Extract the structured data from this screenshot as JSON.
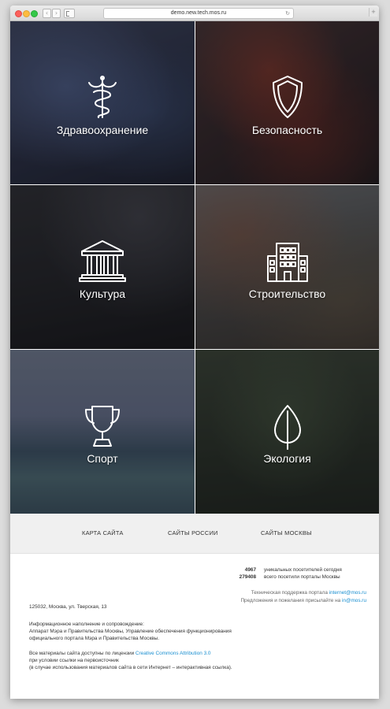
{
  "browser": {
    "url": "demo.new.tech.mos.ru",
    "reload_glyph": "↻",
    "back_glyph": "‹",
    "forward_glyph": "›",
    "newtab_glyph": "+"
  },
  "tiles": [
    {
      "label": "Здравоохранение",
      "icon": "caduceus-icon"
    },
    {
      "label": "Безопасность",
      "icon": "shield-icon"
    },
    {
      "label": "Культура",
      "icon": "museum-icon"
    },
    {
      "label": "Строительство",
      "icon": "building-icon"
    },
    {
      "label": "Спорт",
      "icon": "trophy-icon"
    },
    {
      "label": "Экология",
      "icon": "leaf-icon"
    }
  ],
  "footer_nav": {
    "sitemap": "КАРТА САЙТА",
    "russia_sites": "САЙТЫ РОССИИ",
    "moscow_sites": "САЙТЫ МОСКВЫ"
  },
  "stats": {
    "today_value": "4967",
    "today_label": "уникальных посетителей сегодня",
    "total_value": "279408",
    "total_label": "всего посетили порталы Москвы"
  },
  "support": {
    "line1_text": "Техническая поддержка портала ",
    "line1_email": "internet@mos.ru",
    "line2_text": "Предложения и пожелания присылайте на ",
    "line2_email": "in@mos.ru"
  },
  "address": "125032, Москва, ул. Тверская, 13",
  "info": {
    "line1": "Информационное наполнение и сопровождение:",
    "line2": "Аппарат Мэра и Правительства Москвы, Управление обеспечения функционирования",
    "line3": "официального портала Мэра и Правительства Москвы."
  },
  "license": {
    "line1_text": "Все материалы сайта доступны по лицензии ",
    "line1_link": "Creative Commons Attribution 3.0",
    "line2": "при условии ссылки на первоисточник",
    "line3": "(в случае использования материалов сайта в сети Интернет – интерактивная ссылка)."
  }
}
